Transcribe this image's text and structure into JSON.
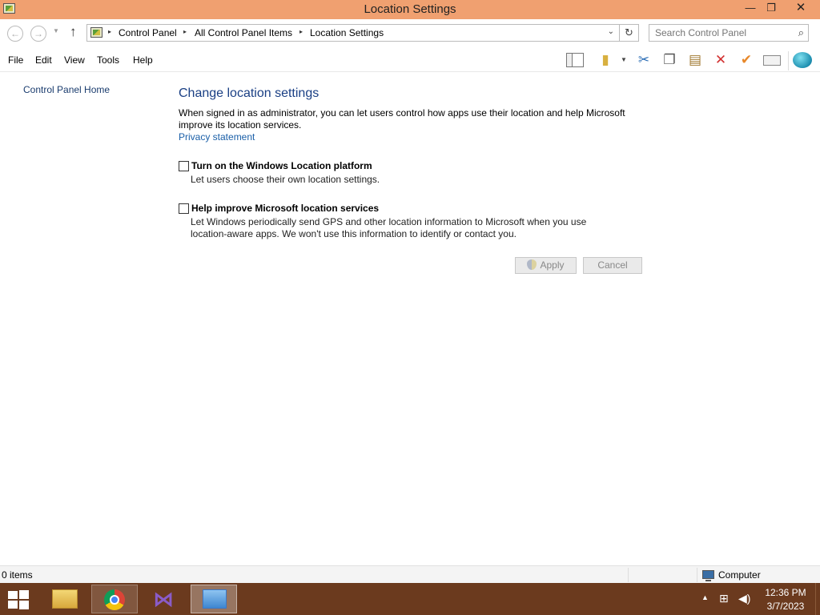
{
  "window": {
    "title": "Location Settings",
    "minimize_glyph": "—",
    "maximize_glyph": "❐",
    "close_glyph": "✕",
    "title_bar_color": "#f0a070"
  },
  "address_bar": {
    "breadcrumbs": [
      "Control Panel",
      "All Control Panel Items",
      "Location Settings"
    ],
    "separator": "▸"
  },
  "search": {
    "placeholder": "Search Control Panel"
  },
  "menu": {
    "items": [
      "File",
      "Edit",
      "View",
      "Tools",
      "Help"
    ]
  },
  "toolbar": {
    "icons": [
      "layout-icon",
      "folder-icon",
      "cut-icon",
      "copy-icon",
      "paste-icon",
      "delete-icon",
      "checkmark-icon",
      "properties-icon",
      "globe-icon"
    ]
  },
  "sidebar": {
    "home_link": "Control Panel Home"
  },
  "main": {
    "title": "Change location settings",
    "description": "When signed in as administrator, you can let users control how apps use their location and help Microsoft improve its location services.",
    "privacy_link": "Privacy statement",
    "options": [
      {
        "title": "Turn on the Windows Location platform",
        "description": "Let users choose their own location settings.",
        "checked": false
      },
      {
        "title": "Help improve Microsoft location services",
        "description": "Let Windows periodically send GPS and other location information to Microsoft when you use location-aware apps. We won't use this information to identify or contact you.",
        "checked": false
      }
    ],
    "apply_label": "Apply",
    "cancel_label": "Cancel",
    "title_color": "#1a3f84",
    "link_color": "#1a5fa8"
  },
  "status_bar": {
    "item_count": "0 items",
    "location": "Computer"
  },
  "taskbar": {
    "apps": [
      "file-explorer",
      "google-chrome",
      "visual-studio",
      "control-panel"
    ],
    "clock_time": "12:36 PM",
    "clock_date": "3/7/2023",
    "color": "#6b3a1e"
  }
}
